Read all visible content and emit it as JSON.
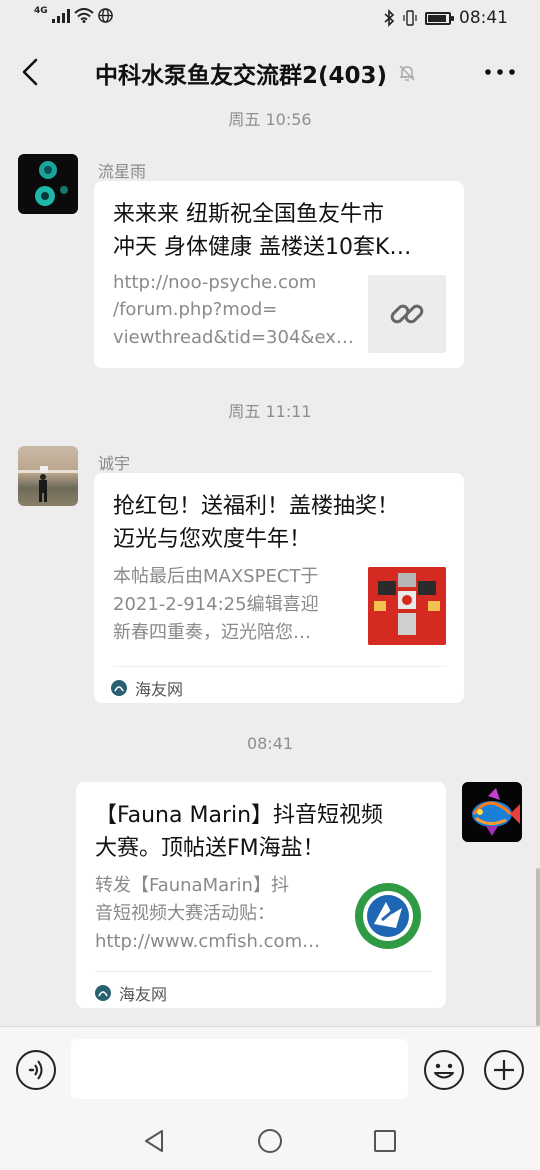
{
  "status_bar": {
    "network": "4G",
    "time": "08:41"
  },
  "header": {
    "back_icon": "chevron-left-icon",
    "title": "中科水泵鱼友交流群2(403)",
    "mute_icon": "bell-mute-icon",
    "more_icon": "more-icon"
  },
  "messages": [
    {
      "timestamp": "周五 10:56",
      "sender": "流星雨",
      "card": {
        "title_line1": "来来来 纽斯祝全国鱼友牛市",
        "title_line2": "冲天 身体健康 盖楼送10套K…",
        "desc_line1": "http://noo-psyche.com",
        "desc_line2": "/forum.php?mod=",
        "desc_line3": "viewthread&tid=304&ex…",
        "thumb_icon": "link-icon"
      }
    },
    {
      "timestamp": "周五 11:11",
      "sender": "诚宇",
      "card": {
        "title_line1": "抢红包！送福利！盖楼抽奖！",
        "title_line2": "迈光与您欢度牛年！",
        "desc_line1": "本帖最后由MAXSPECT于",
        "desc_line2": "2021-2-914:25编辑喜迎",
        "desc_line3": "新春四重奏，迈光陪您…",
        "source": "海友网"
      }
    },
    {
      "timestamp": "08:41",
      "sender": "",
      "card": {
        "title_line1": "【Fauna Marin】抖音短视频",
        "title_line2": "大赛。顶帖送FM海盐！",
        "desc_line1": "转发【FaunaMarin】抖",
        "desc_line2": "音短视频大赛活动贴：",
        "desc_line3": "http://www.cmfish.com…",
        "source": "海友网"
      }
    }
  ],
  "input_bar": {
    "voice_icon": "voice-icon",
    "emoji_icon": "emoji-icon",
    "plus_icon": "plus-icon"
  },
  "nav_bar": {
    "back_icon": "nav-back-icon",
    "home_icon": "nav-home-icon",
    "recents_icon": "nav-recents-icon"
  },
  "colors": {
    "background": "#ededed",
    "card": "#ffffff",
    "muted_text": "#8a8a8a"
  }
}
